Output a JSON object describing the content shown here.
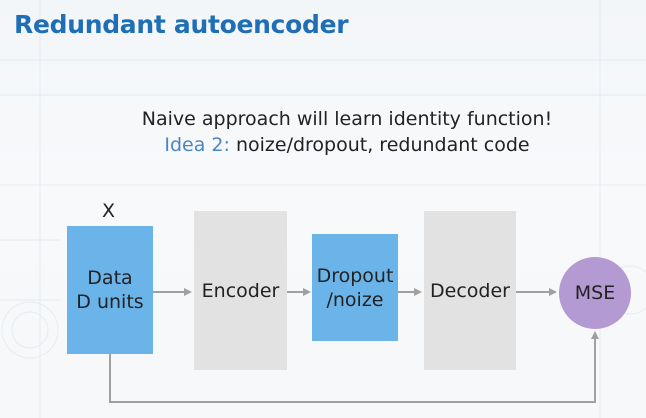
{
  "title": "Redundant autoencoder",
  "subtitle": {
    "line1": "Naive approach will learn identity function!",
    "line2_label": "Idea 2:",
    "line2_text": " noize/dropout, redundant code"
  },
  "input_label": "X",
  "blocks": {
    "data": {
      "line1": "Data",
      "line2": "D units"
    },
    "encoder": "Encoder",
    "dropout": {
      "line1": "Dropout",
      "line2": "/noize"
    },
    "decoder": "Decoder",
    "mse": "MSE"
  },
  "colors": {
    "title": "#1f6fb6",
    "idea_label": "#4a86c6",
    "blue_block": "#6ab4ea",
    "gray_block": "#e2e2e2",
    "mse_circle": "#b39ad2",
    "arrow": "#a0a0a0"
  }
}
